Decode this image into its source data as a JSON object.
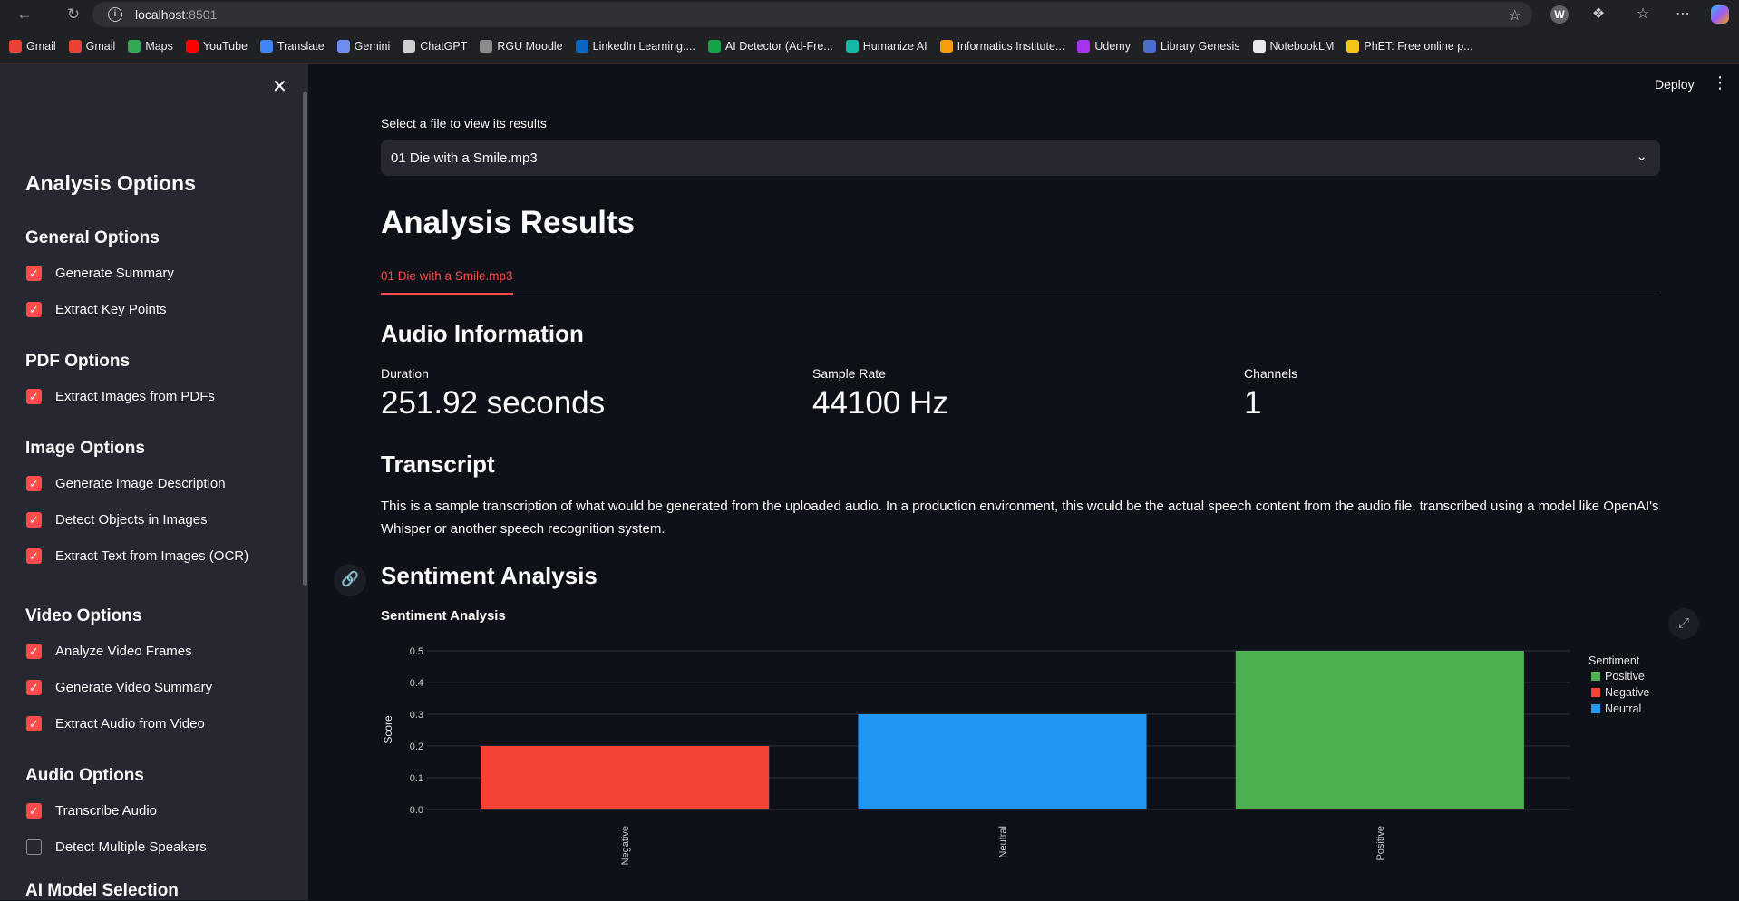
{
  "browser": {
    "url_host": "localhost",
    "url_port": ":8501",
    "bookmarks": [
      {
        "label": "Gmail",
        "color": "#ea4335"
      },
      {
        "label": "Gmail",
        "color": "#ea4335"
      },
      {
        "label": "Maps",
        "color": "#34a853"
      },
      {
        "label": "YouTube",
        "color": "#ff0000"
      },
      {
        "label": "Translate",
        "color": "#4285f4"
      },
      {
        "label": "Gemini",
        "color": "#6f8cf0"
      },
      {
        "label": "ChatGPT",
        "color": "#d0d0d0"
      },
      {
        "label": "RGU Moodle",
        "color": "#8a8a8a"
      },
      {
        "label": "LinkedIn Learning:...",
        "color": "#0a66c2"
      },
      {
        "label": "AI Detector (Ad-Fre...",
        "color": "#16a34a"
      },
      {
        "label": "Humanize AI",
        "color": "#14b8a6"
      },
      {
        "label": "Informatics Institute...",
        "color": "#f59e0b"
      },
      {
        "label": "Udemy",
        "color": "#a435f0"
      },
      {
        "label": "Library Genesis",
        "color": "#4a6fd0"
      },
      {
        "label": "NotebookLM",
        "color": "#e8eaed"
      },
      {
        "label": "PhET: Free online p...",
        "color": "#f5c518"
      }
    ]
  },
  "sidebar": {
    "title": "Analysis Options",
    "sections": [
      {
        "heading": "General Options",
        "items": [
          {
            "label": "Generate Summary",
            "checked": true
          },
          {
            "label": "Extract Key Points",
            "checked": true
          }
        ]
      },
      {
        "heading": "PDF Options",
        "items": [
          {
            "label": "Extract Images from PDFs",
            "checked": true
          }
        ]
      },
      {
        "heading": "Image Options",
        "items": [
          {
            "label": "Generate Image Description",
            "checked": true
          },
          {
            "label": "Detect Objects in Images",
            "checked": true
          },
          {
            "label": "Extract Text from Images (OCR)",
            "checked": true
          }
        ]
      },
      {
        "heading": "Video Options",
        "items": [
          {
            "label": "Analyze Video Frames",
            "checked": true
          },
          {
            "label": "Generate Video Summary",
            "checked": true
          },
          {
            "label": "Extract Audio from Video",
            "checked": true
          }
        ]
      },
      {
        "heading": "Audio Options",
        "items": [
          {
            "label": "Transcribe Audio",
            "checked": true
          },
          {
            "label": "Detect Multiple Speakers",
            "checked": false
          }
        ]
      },
      {
        "heading": "AI Model Selection",
        "items": []
      }
    ]
  },
  "header": {
    "deploy_label": "Deploy"
  },
  "main": {
    "select_label": "Select a file to view its results",
    "selected_file": "01 Die with a Smile.mp3",
    "results_title": "Analysis Results",
    "tab_label": "01 Die with a Smile.mp3",
    "audio_heading": "Audio Information",
    "metrics": [
      {
        "label": "Duration",
        "value": "251.92 seconds"
      },
      {
        "label": "Sample Rate",
        "value": "44100 Hz"
      },
      {
        "label": "Channels",
        "value": "1"
      }
    ],
    "transcript_heading": "Transcript",
    "transcript_text": "This is a sample transcription of what would be generated from the uploaded audio. In a production environment, this would be the actual speech content from the audio file, transcribed using a model like OpenAI's Whisper or another speech recognition system.",
    "sentiment_heading": "Sentiment Analysis"
  },
  "chart_data": {
    "type": "bar",
    "title": "Sentiment Analysis",
    "xlabel": "",
    "ylabel": "Score",
    "categories": [
      "Negative",
      "Neutral",
      "Positive"
    ],
    "values": [
      0.2,
      0.3,
      0.5
    ],
    "colors": [
      "#f44336",
      "#2196f3",
      "#4caf50"
    ],
    "ylim": [
      0,
      0.5
    ],
    "yticks": [
      "0.0",
      "0.1",
      "0.2",
      "0.3",
      "0.4",
      "0.5"
    ],
    "legend": {
      "title": "Sentiment",
      "placement": "right",
      "entries": [
        {
          "name": "Positive",
          "color": "#4caf50"
        },
        {
          "name": "Negative",
          "color": "#f44336"
        },
        {
          "name": "Neutral",
          "color": "#2196f3"
        }
      ]
    },
    "grid": true
  }
}
